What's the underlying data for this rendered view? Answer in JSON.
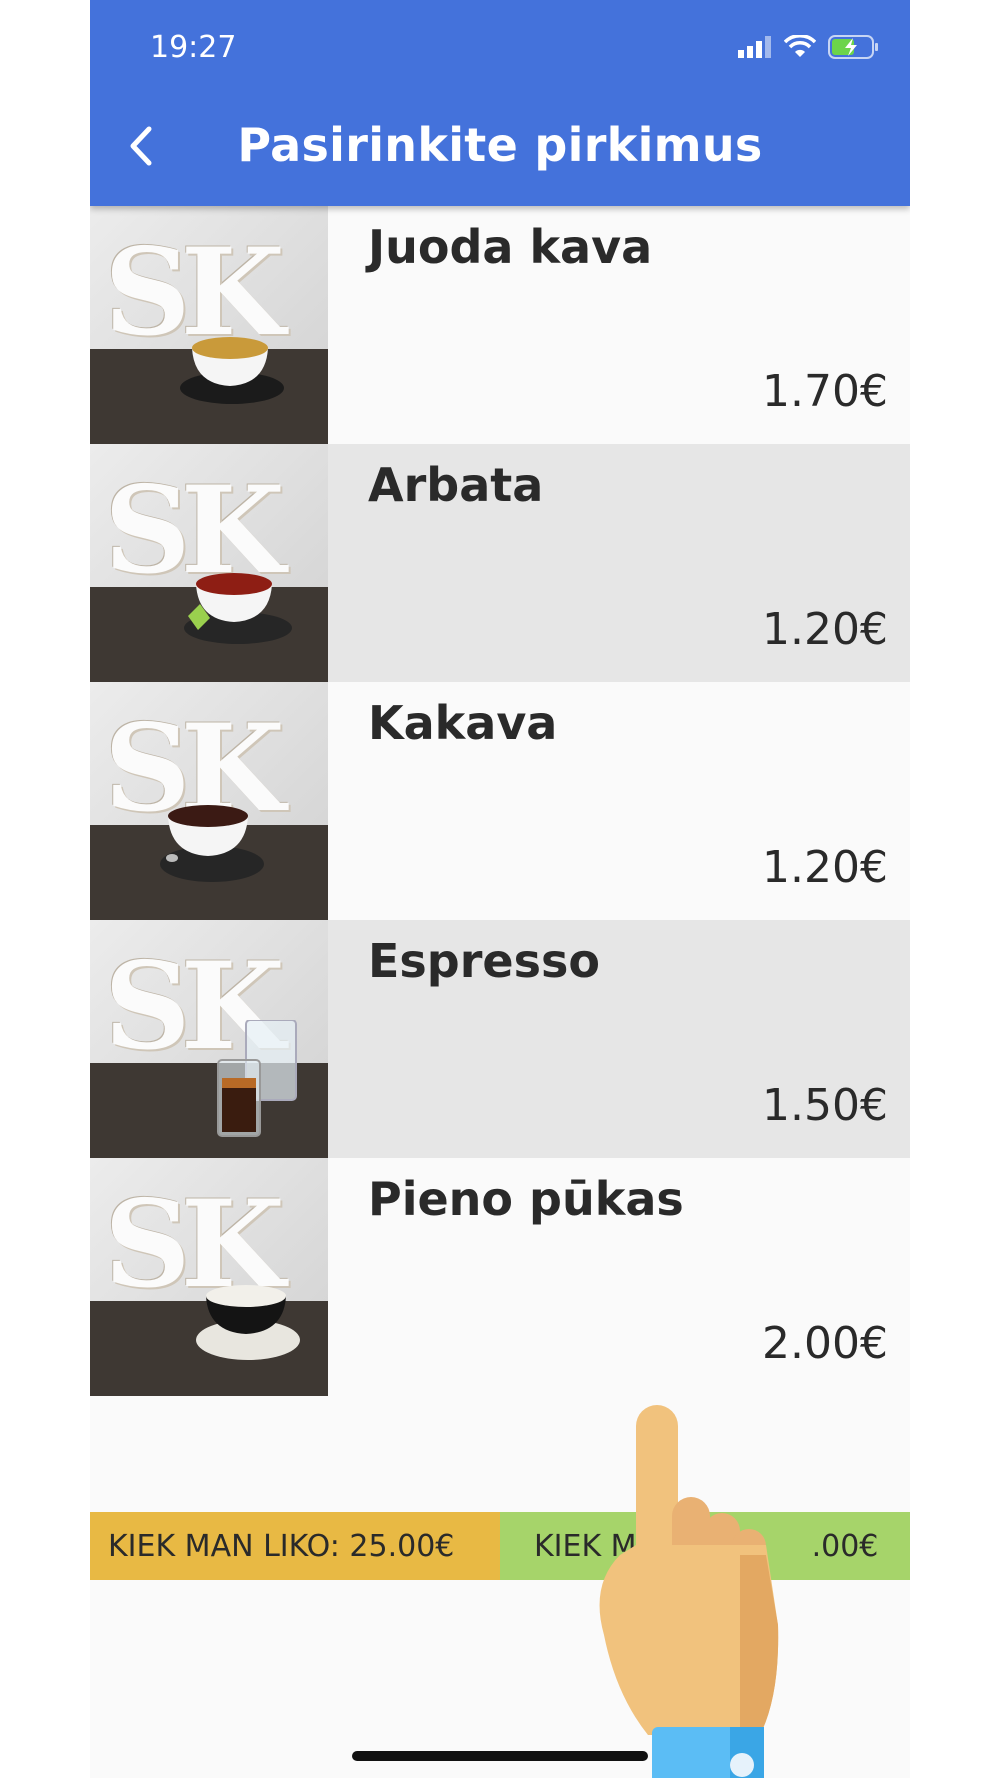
{
  "status_bar": {
    "time": "19:27"
  },
  "app_bar": {
    "title": "Pasirinkite pirkimus"
  },
  "products": [
    {
      "name": "Juoda kava",
      "price": "1.70€",
      "image_logo": "SK",
      "drink_color": "#c99a3a"
    },
    {
      "name": "Arbata",
      "price": "1.20€",
      "image_logo": "SK",
      "drink_color": "#8e1e14"
    },
    {
      "name": "Kakava",
      "price": "1.20€",
      "image_logo": "SK",
      "drink_color": "#3b1a14"
    },
    {
      "name": "Espresso",
      "price": "1.50€",
      "image_logo": "SK",
      "drink_color": "#3a1c0f"
    },
    {
      "name": "Pieno pūkas",
      "price": "2.00€",
      "image_logo": "SK",
      "drink_color": "#f2f0ea"
    }
  ],
  "footer": {
    "left_label": "KIEK MAN LIKO: 25.00€",
    "right_label_left": "KIEK M",
    "right_label_right": ".00€"
  },
  "colors": {
    "app_bar": "#4472db",
    "footer_left": "#e8b944",
    "footer_right": "#a6d46a",
    "alt_row": "#e6e6e6"
  }
}
